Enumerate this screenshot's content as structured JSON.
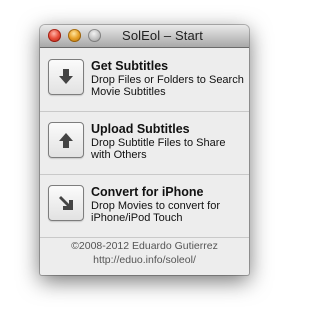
{
  "window": {
    "title": "SolEol – Start"
  },
  "actions": [
    {
      "title": "Get Subtitles",
      "description": "Drop Files or Folders to Search Movie Subtitles",
      "icon": "arrow-down-icon"
    },
    {
      "title": "Upload Subtitles",
      "description": "Drop Subtitle Files to Share with Others",
      "icon": "arrow-up-icon"
    },
    {
      "title": "Convert for iPhone",
      "description": "Drop Movies to convert for iPhone/iPod Touch",
      "icon": "arrow-diagonal-icon"
    }
  ],
  "footer": {
    "copyright": "©2008-2012 Eduardo Gutierrez",
    "url": "http://eduo.info/soleol/"
  }
}
